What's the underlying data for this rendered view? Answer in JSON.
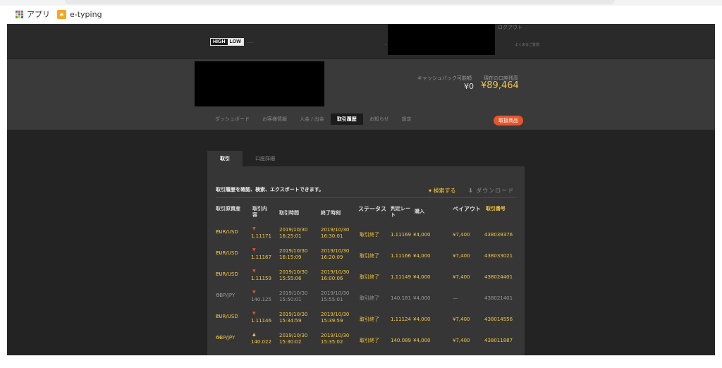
{
  "bookmarks": [
    {
      "icon": "apps-grid-icon",
      "label": "アプリ"
    },
    {
      "icon": "e-typing-icon",
      "label": "e-typing"
    }
  ],
  "header": {
    "logo_high": "HIGH",
    "logo_low": "LOW",
    "logo_sub": "......",
    "top_right_link": "ログアウト",
    "top_right_sub": "よくあるご質問",
    "top_dot": "・"
  },
  "account": {
    "cashback_label": "キャッシュバック可能額",
    "cashback_value": "¥0",
    "balance_label": "現在の口座残高",
    "balance_value": "¥89,464"
  },
  "nav": {
    "items": [
      "ダッシュボード",
      "お客様情報",
      "入金 / 出金",
      "取引履歴",
      "お知らせ",
      "設定"
    ],
    "active_index": 3,
    "badge": "取扱商品"
  },
  "panel": {
    "tabs": [
      "取引",
      "口座詳細"
    ],
    "description": "取引履歴を確認、検索、エクスポートできます。",
    "search_label": "▾ 検索する",
    "download_label": "⬇ ダウンロード"
  },
  "table": {
    "columns": [
      "取引原資産",
      "取引内容",
      "取引時間",
      "終了時刻",
      "ステータス",
      "判定レート",
      "購入",
      "ペイアウト",
      "取引番号"
    ],
    "rows": [
      {
        "asset": "EUR/USD",
        "direction": "down",
        "rate": "1.11171",
        "start_date": "2019/10/30",
        "start_time": "16:25:01",
        "end_date": "2019/10/30",
        "end_time": "16:30:01",
        "status": "取引終了",
        "judge_rate": "1.11169",
        "purchase": "¥4,000",
        "payout": "¥7,400",
        "trade_id": "438039376",
        "win": true
      },
      {
        "asset": "EUR/USD",
        "direction": "down",
        "rate": "1.11167",
        "start_date": "2019/10/30",
        "start_time": "16:15:09",
        "end_date": "2019/10/30",
        "end_time": "16:20:09",
        "status": "取引終了",
        "judge_rate": "1.11166",
        "purchase": "¥4,000",
        "payout": "¥7,400",
        "trade_id": "438033021",
        "win": true
      },
      {
        "asset": "EUR/USD",
        "direction": "down",
        "rate": "1.11159",
        "start_date": "2019/10/30",
        "start_time": "15:55:06",
        "end_date": "2019/10/30",
        "end_time": "16:00:06",
        "status": "取引終了",
        "judge_rate": "1.11149",
        "purchase": "¥4,000",
        "payout": "¥7,400",
        "trade_id": "438024401",
        "win": true
      },
      {
        "asset": "GBP/JPY",
        "direction": "down",
        "rate": "140.125",
        "start_date": "2019/10/30",
        "start_time": "15:50:01",
        "end_date": "2019/10/30",
        "end_time": "15:55:01",
        "status": "取引終了",
        "judge_rate": "140.181",
        "purchase": "¥4,000",
        "payout": "—",
        "trade_id": "438021401",
        "win": false
      },
      {
        "asset": "EUR/USD",
        "direction": "down",
        "rate": "1.11146",
        "start_date": "2019/10/30",
        "start_time": "15:34:59",
        "end_date": "2019/10/30",
        "end_time": "15:39:59",
        "status": "取引終了",
        "judge_rate": "1.11124",
        "purchase": "¥4,000",
        "payout": "¥7,400",
        "trade_id": "438014556",
        "win": true
      },
      {
        "asset": "GBP/JPY",
        "direction": "up",
        "rate": "140.022",
        "start_date": "2019/10/30",
        "start_time": "15:30:02",
        "end_date": "2019/10/30",
        "end_time": "15:35:02",
        "status": "取引終了",
        "judge_rate": "140.089",
        "purchase": "¥4,000",
        "payout": "¥7,400",
        "trade_id": "438011887",
        "win": true
      }
    ]
  },
  "colors": {
    "gold": "#f5c842",
    "badge": "#e4572e",
    "panel": "#363636"
  }
}
